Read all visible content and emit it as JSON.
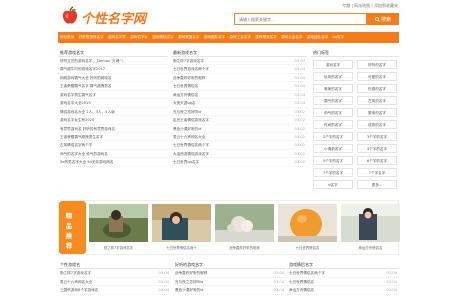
{
  "header": {
    "top_links": "专题 | 网站地图 | 添加到收藏夹",
    "logo_text": "个性名字网",
    "search_placeholder": "请输入搜索关键字...",
    "search_button": "搜索"
  },
  "nav": [
    "网站首页",
    "好听的游戏名字",
    "游戏名字男",
    "游戏名字女",
    "游戏情侣名字",
    "游戏家族名字",
    "游戏团队名字",
    "游戏工会名字",
    "游戏帮派名字",
    "游戏公会名字",
    "游戏战队名字",
    "qq名字"
  ],
  "recommend": {
    "title": "推荐游戏名字",
    "items": [
      "好听文艺的游戏名字_-_Demon`灭魂^)",
      "霸气超牛叼的游戏名字2017",
      "网络游戏霸气大全 好听的网络名",
      "王者荣耀霸气名字 霸气超拽男名",
      "游戏名字男生霸气名字",
      "游戏名字大全2019",
      "情侣游戏名大全 2人、3人、4人版",
      "游戏名字女生有2020",
      "有意思游戏名 好听的有意思游戏名",
      "王者荣耀霸气超拽男生名字",
      "古风情侣名字两个字",
      "帅气的名字大全 帅气的游戏名",
      "5d的男名字大全 5d无奈游戏网名"
    ]
  },
  "latest": {
    "title": "最新游戏名字",
    "items": [
      {
        "text": "勤之祥7字游戏名字",
        "date": "03-04"
      },
      {
        "text": "七日世界游戏名两个字",
        "date": "03-04"
      },
      {
        "text": "战争轰炸好听的昵称",
        "date": "03-04"
      },
      {
        "text": "七日世界情侣名",
        "date": "03-04"
      },
      {
        "text": "命运方舟情侣名",
        "date": "03-04"
      },
      {
        "text": "大侠天涯qq名",
        "date": "03-04"
      },
      {
        "text": "光与夜之恋好听id",
        "date": "03-02"
      },
      {
        "text": "乱世王者情侣游戏名字",
        "date": "03-02"
      },
      {
        "text": "黑色沙漠好听的id",
        "date": "03-02"
      },
      {
        "text": "虽云十六声网名大全",
        "date": "03-02"
      },
      {
        "text": "七日世界情侣名两个字",
        "date": "03-02"
      },
      {
        "text": "大话西游情侣游戏名字",
        "date": "03-02"
      },
      {
        "text": "七日世界qq名字",
        "date": "03-02"
      }
    ]
  },
  "hot_tags": {
    "title": "热门标签",
    "items": [
      "游戏名字",
      "好听的名字",
      "玩风的名字",
      "可爱的名字",
      "唯美的名字",
      "伤感的名字",
      "霸气的名字",
      "古风的名字",
      "帅气的名字",
      "繁体的名字",
      "时尚的名字",
      "成熟的名字",
      "2个字的名字",
      "3个字的名字",
      "小清新名字",
      "4个字的名字",
      "5个字的名字",
      "6个字的名字",
      "7个字的名字",
      "7个字名字",
      "d名字",
      "更多..."
    ]
  },
  "featured": {
    "badge": "精品推荐",
    "cards": [
      "勤之祥7字游戏名字",
      "七日世界情侣名两个",
      "战争轰炸好听的昵称",
      "七日世界情侣名",
      "命运方舟情侣名"
    ]
  },
  "bottom": [
    {
      "title": "个性游戏名",
      "items": [
        {
          "text": "勤之祥7字游戏名字",
          "date": "03-04"
        },
        {
          "text": "虽云十六声网名大全",
          "date": "03-04"
        },
        {
          "text": "三国杀游戏8个字游戏名",
          "date": "03-04"
        }
      ]
    },
    {
      "title": "好听的游戏名字",
      "items": [
        {
          "text": "战争轰炸好听的昵称",
          "date": "03-04"
        },
        {
          "text": "光与夜之恋好听id",
          "date": "03-04"
        },
        {
          "text": "黑色沙漠好听的id",
          "date": "03-04"
        }
      ]
    },
    {
      "title": "游戏情侣名字",
      "items": [
        {
          "text": "七日世界情侣名两个字",
          "date": "03-04"
        },
        {
          "text": "七日世界情侣名",
          "date": "03-04"
        },
        {
          "text": "命运方舟情侣名",
          "date": "03-04"
        }
      ]
    }
  ],
  "colors": {
    "accent": "#f57c16",
    "badge": "#f68b1f"
  }
}
